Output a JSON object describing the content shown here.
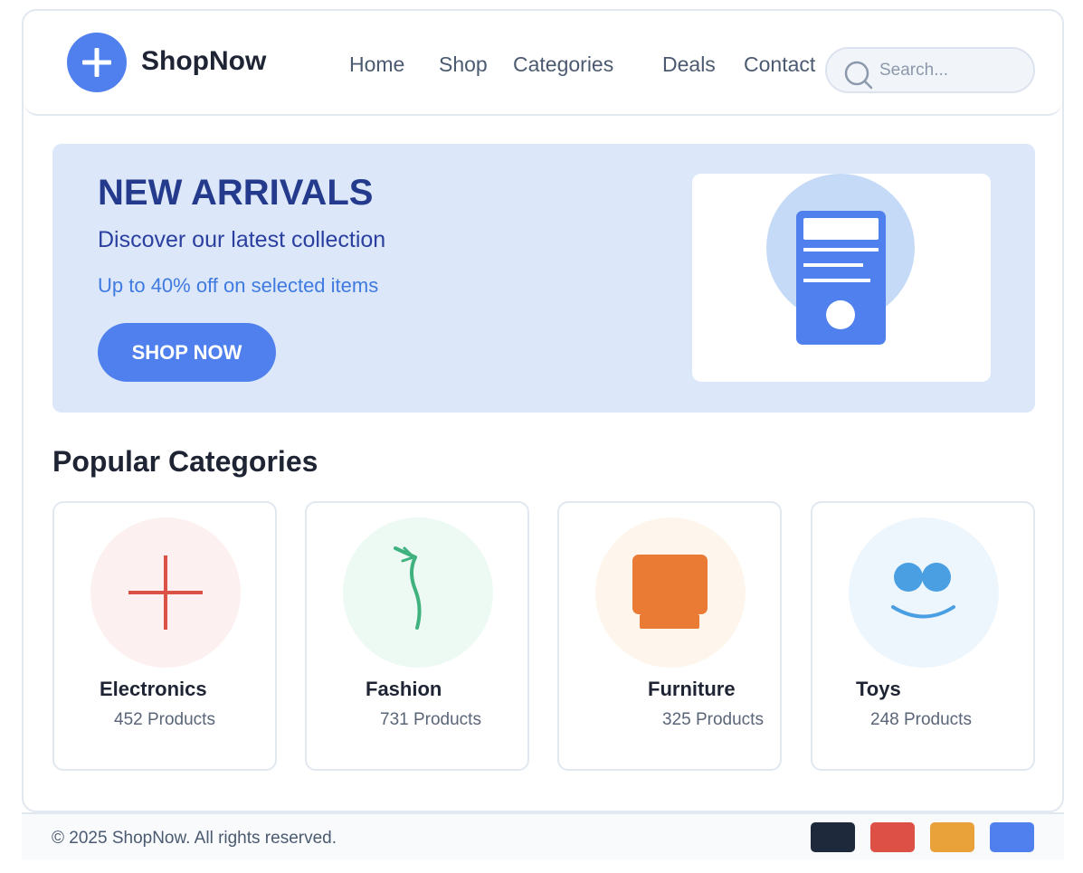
{
  "brand": {
    "name": "ShopNow",
    "logo_icon": "plus-icon",
    "color": "#4f80ed"
  },
  "nav": {
    "items": [
      {
        "label": "Home"
      },
      {
        "label": "Shop"
      },
      {
        "label": "Categories"
      },
      {
        "label": "Deals"
      },
      {
        "label": "Contact"
      }
    ]
  },
  "search": {
    "placeholder": "Search...",
    "icon": "search-icon"
  },
  "hero": {
    "title": "NEW ARRIVALS",
    "subtitle": "Discover our latest collection",
    "offer": "Up to 40% off on selected items",
    "button_label": "SHOP NOW",
    "illustration_icon": "document-device-icon"
  },
  "categories_section": {
    "title": "Popular Categories",
    "items": [
      {
        "name": "Electronics",
        "count": "452 Products",
        "icon": "electronics-plus-icon",
        "color": "#dc5046",
        "bg": "#fdf0f0"
      },
      {
        "name": "Fashion",
        "count": "731 Products",
        "icon": "fashion-curve-icon",
        "color": "#3fb27f",
        "bg": "#edf9f3"
      },
      {
        "name": "Furniture",
        "count": "325 Products",
        "icon": "furniture-chair-icon",
        "color": "#e97b34",
        "bg": "#fef6ec"
      },
      {
        "name": "Toys",
        "count": "248 Products",
        "icon": "toys-smile-icon",
        "color": "#4a9fe3",
        "bg": "#eef6fd"
      }
    ]
  },
  "footer": {
    "copyright": "© 2025 ShopNow. All rights reserved.",
    "swatches": [
      "#1e293b",
      "#dc5046",
      "#e9a23a",
      "#4f80ed"
    ]
  }
}
